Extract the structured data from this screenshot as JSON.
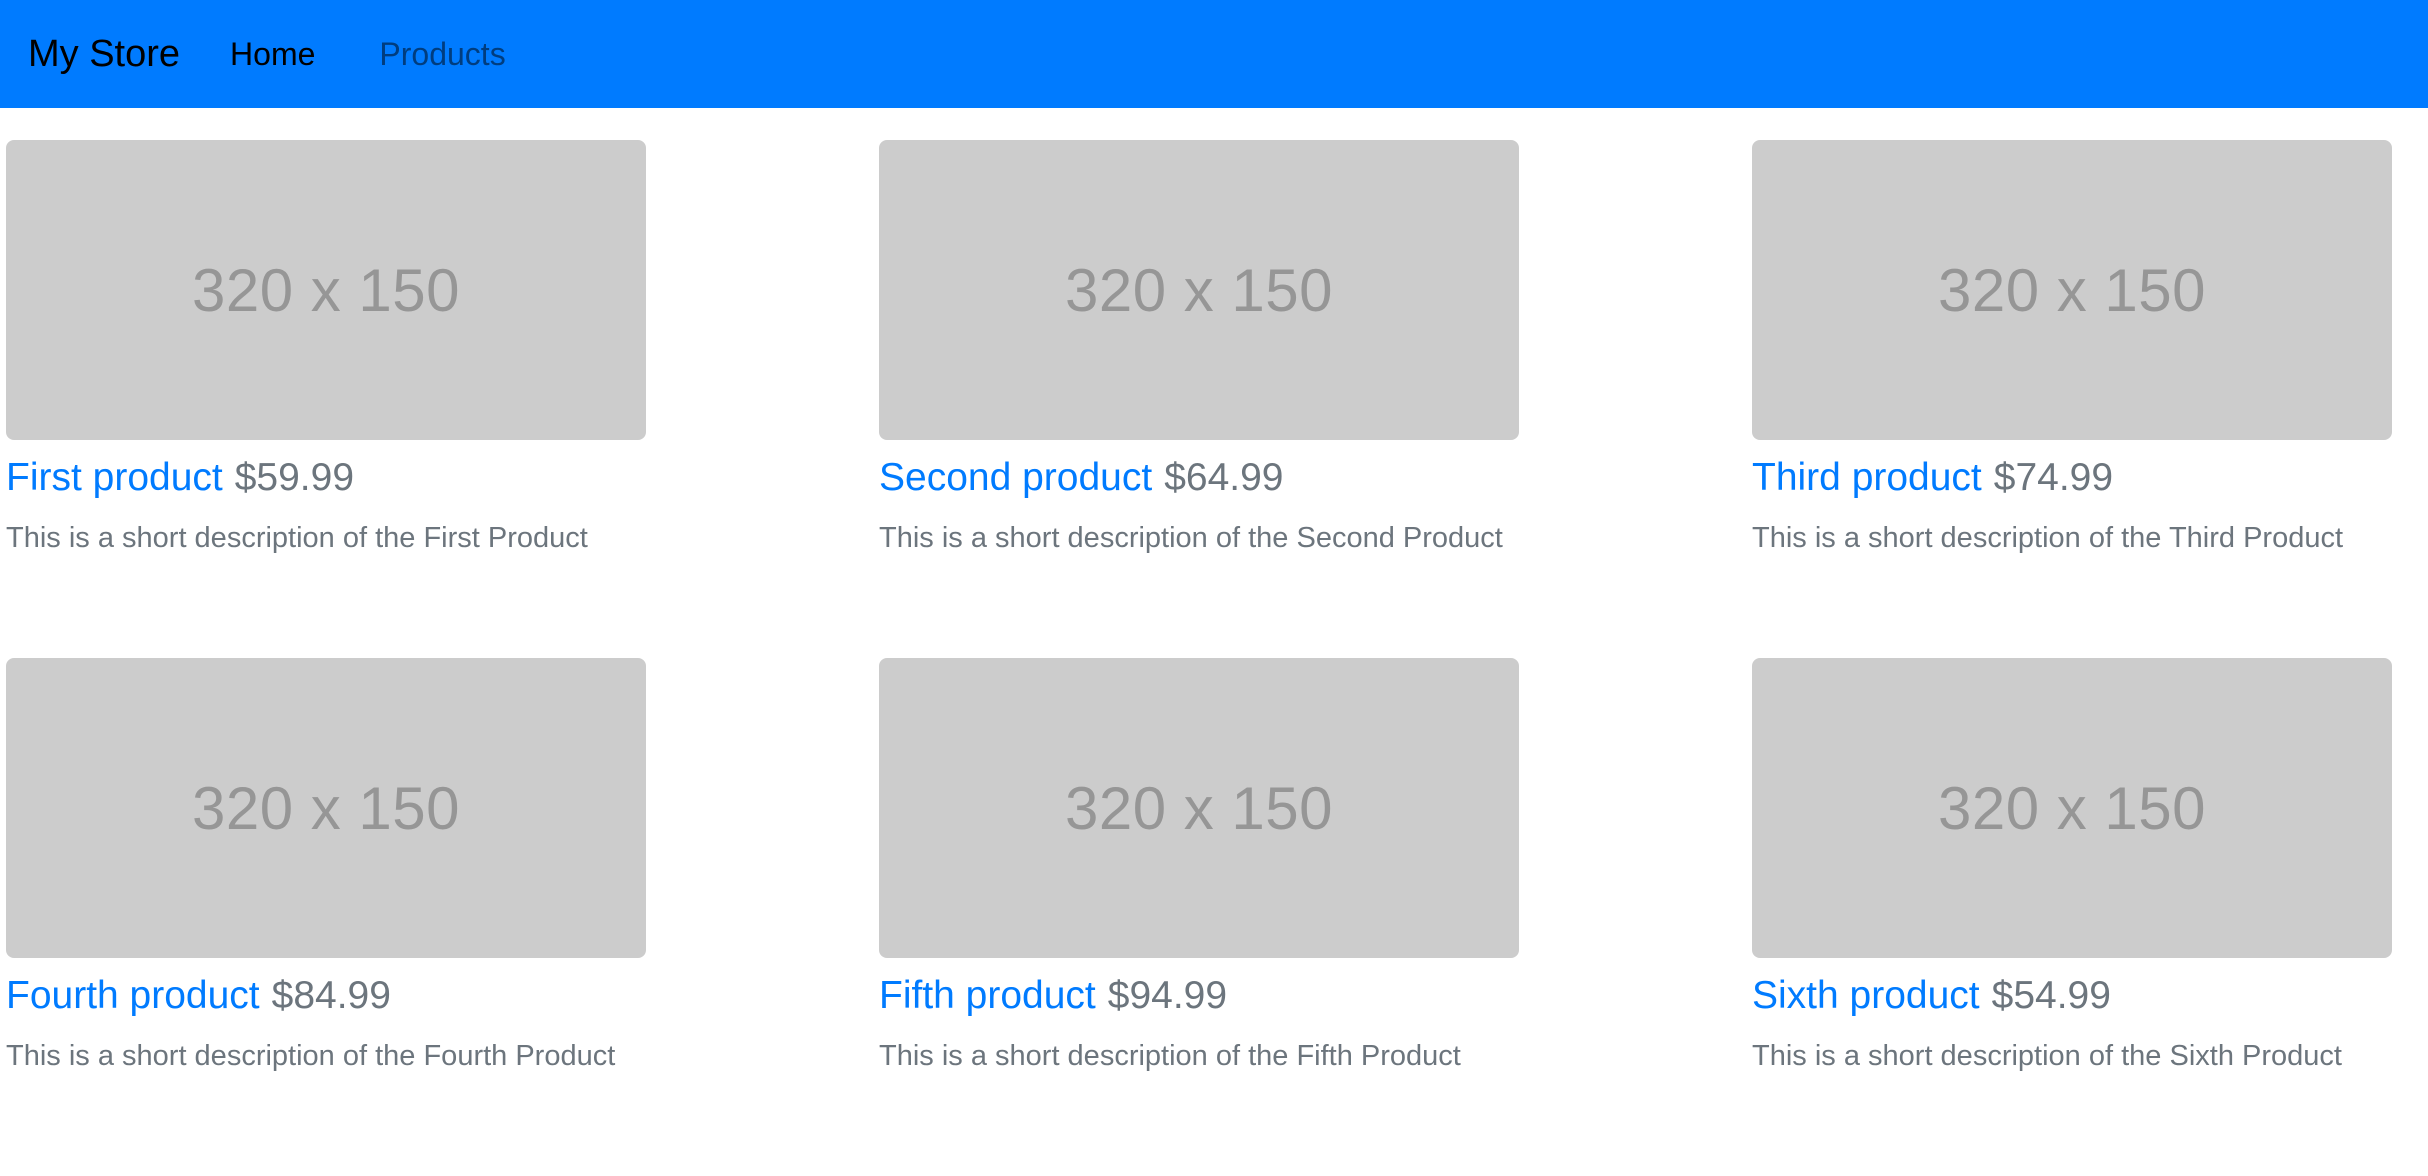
{
  "navbar": {
    "brand": "My Store",
    "links": [
      {
        "label": "Home"
      },
      {
        "label": "Products"
      }
    ],
    "bg_color": "#007bff"
  },
  "products": [
    {
      "image_label": "320 x 150",
      "name": "First product",
      "price": "$59.99",
      "description": "This is a short description of the First Product"
    },
    {
      "image_label": "320 x 150",
      "name": "Second product",
      "price": "$64.99",
      "description": "This is a short description of the Second Product"
    },
    {
      "image_label": "320 x 150",
      "name": "Third product",
      "price": "$74.99",
      "description": "This is a short description of the Third Product"
    },
    {
      "image_label": "320 x 150",
      "name": "Fourth product",
      "price": "$84.99",
      "description": "This is a short description of the Fourth Product"
    },
    {
      "image_label": "320 x 150",
      "name": "Fifth product",
      "price": "$94.99",
      "description": "This is a short description of the Fifth Product"
    },
    {
      "image_label": "320 x 150",
      "name": "Sixth product",
      "price": "$54.99",
      "description": "This is a short description of the Sixth Product"
    }
  ],
  "colors": {
    "link": "#007bff",
    "muted": "#6c757d",
    "placeholder_bg": "#cccccc",
    "placeholder_text": "#969696"
  }
}
